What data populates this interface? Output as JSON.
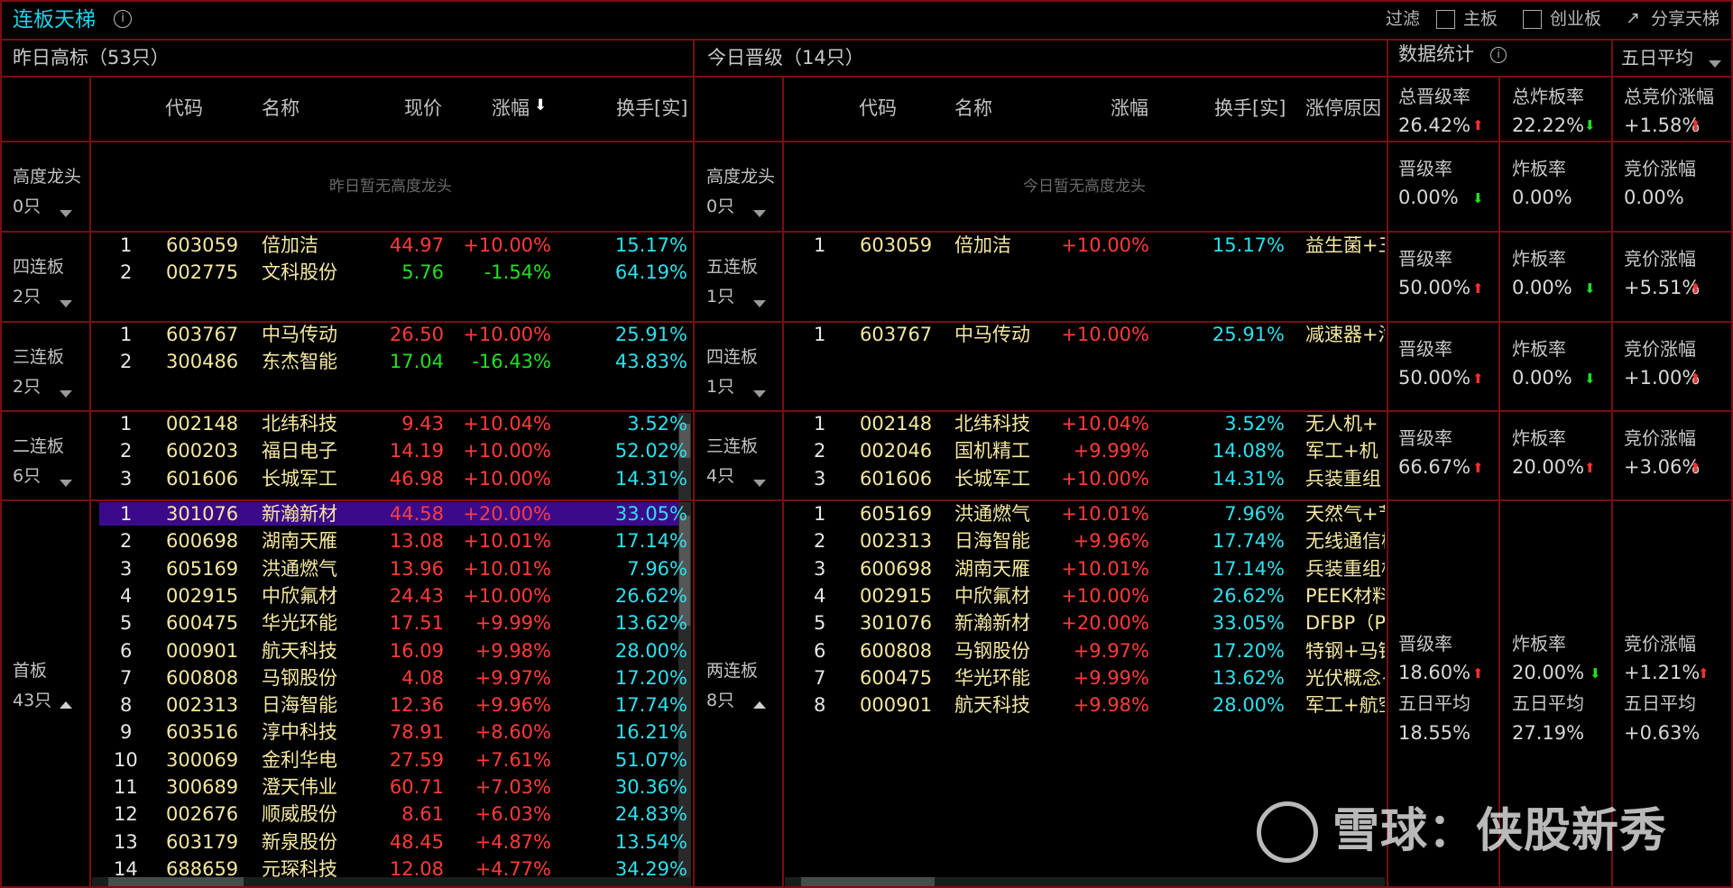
{
  "header": {
    "title": "连板天梯",
    "filter_label": "过滤",
    "main_board": "主板",
    "gem_board": "创业板",
    "share": "分享天梯"
  },
  "left": {
    "title": "昨日高标（53只）",
    "col_code": "代码",
    "col_name": "名称",
    "col_price": "现价",
    "col_change": "涨幅",
    "col_turnover": "换手[实]",
    "empty_text": "昨日暂无高度龙头"
  },
  "mid": {
    "title": "今日晋级（14只）",
    "col_code": "代码",
    "col_name": "名称",
    "col_change": "涨幅",
    "col_turnover": "换手[实]",
    "col_reason": "涨停原因",
    "empty_text": "今日暂无高度龙头"
  },
  "stats": {
    "title": "数据统计",
    "period": "五日平均",
    "total": [
      {
        "label": "总晋级率",
        "value": "26.42%",
        "dir": "up"
      },
      {
        "label": "总炸板率",
        "value": "22.22%",
        "dir": "down"
      },
      {
        "label": "总竞价涨幅",
        "value": "+1.58%",
        "dir": "up"
      }
    ]
  },
  "groups_left": [
    {
      "label": "高度龙头",
      "count": "0只"
    },
    {
      "label": "四连板",
      "count": "2只"
    },
    {
      "label": "三连板",
      "count": "2只"
    },
    {
      "label": "二连板",
      "count": "6只"
    },
    {
      "label": "首板",
      "count": "43只"
    }
  ],
  "groups_mid": [
    {
      "label": "高度龙头",
      "count": "0只"
    },
    {
      "label": "五连板",
      "count": "1只"
    },
    {
      "label": "四连板",
      "count": "1只"
    },
    {
      "label": "三连板",
      "count": "4只"
    },
    {
      "label": "两连板",
      "count": "8只"
    }
  ],
  "left_rows": {
    "g4": [
      {
        "i": "1",
        "code": "603059",
        "name": "倍加洁",
        "price": "44.97",
        "chg": "+10.00%",
        "to": "15.17%",
        "pc": "r"
      },
      {
        "i": "2",
        "code": "002775",
        "name": "文科股份",
        "price": "5.76",
        "chg": "-1.54%",
        "to": "64.19%",
        "pc": "g"
      }
    ],
    "g3": [
      {
        "i": "1",
        "code": "603767",
        "name": "中马传动",
        "price": "26.50",
        "chg": "+10.00%",
        "to": "25.91%",
        "pc": "r"
      },
      {
        "i": "2",
        "code": "300486",
        "name": "东杰智能",
        "price": "17.04",
        "chg": "-16.43%",
        "to": "43.83%",
        "pc": "g"
      }
    ],
    "g2": [
      {
        "i": "1",
        "code": "002148",
        "name": "北纬科技",
        "price": "9.43",
        "chg": "+10.04%",
        "to": "3.52%",
        "pc": "r"
      },
      {
        "i": "2",
        "code": "600203",
        "name": "福日电子",
        "price": "14.19",
        "chg": "+10.00%",
        "to": "52.02%",
        "pc": "r"
      },
      {
        "i": "3",
        "code": "601606",
        "name": "长城军工",
        "price": "46.98",
        "chg": "+10.00%",
        "to": "14.31%",
        "pc": "r"
      }
    ],
    "g1": [
      {
        "i": "1",
        "code": "301076",
        "name": "新瀚新材",
        "price": "44.58",
        "chg": "+20.00%",
        "to": "33.05%",
        "pc": "r"
      },
      {
        "i": "2",
        "code": "600698",
        "name": "湖南天雁",
        "price": "13.08",
        "chg": "+10.01%",
        "to": "17.14%",
        "pc": "r"
      },
      {
        "i": "3",
        "code": "605169",
        "name": "洪通燃气",
        "price": "13.96",
        "chg": "+10.01%",
        "to": "7.96%",
        "pc": "r"
      },
      {
        "i": "4",
        "code": "002915",
        "name": "中欣氟材",
        "price": "24.43",
        "chg": "+10.00%",
        "to": "26.62%",
        "pc": "r"
      },
      {
        "i": "5",
        "code": "600475",
        "name": "华光环能",
        "price": "17.51",
        "chg": "+9.99%",
        "to": "13.62%",
        "pc": "r"
      },
      {
        "i": "6",
        "code": "000901",
        "name": "航天科技",
        "price": "16.09",
        "chg": "+9.98%",
        "to": "28.00%",
        "pc": "r"
      },
      {
        "i": "7",
        "code": "600808",
        "name": "马钢股份",
        "price": "4.08",
        "chg": "+9.97%",
        "to": "17.20%",
        "pc": "r"
      },
      {
        "i": "8",
        "code": "002313",
        "name": "日海智能",
        "price": "12.36",
        "chg": "+9.96%",
        "to": "17.74%",
        "pc": "r"
      },
      {
        "i": "9",
        "code": "603516",
        "name": "淳中科技",
        "price": "78.91",
        "chg": "+8.60%",
        "to": "16.21%",
        "pc": "r"
      },
      {
        "i": "10",
        "code": "300069",
        "name": "金利华电",
        "price": "27.59",
        "chg": "+7.61%",
        "to": "51.07%",
        "pc": "r"
      },
      {
        "i": "11",
        "code": "300689",
        "name": "澄天伟业",
        "price": "60.71",
        "chg": "+7.03%",
        "to": "30.36%",
        "pc": "r"
      },
      {
        "i": "12",
        "code": "002676",
        "name": "顺威股份",
        "price": "8.61",
        "chg": "+6.03%",
        "to": "24.83%",
        "pc": "r"
      },
      {
        "i": "13",
        "code": "603179",
        "name": "新泉股份",
        "price": "48.45",
        "chg": "+4.87%",
        "to": "13.54%",
        "pc": "r"
      },
      {
        "i": "14",
        "code": "688659",
        "name": "元琛科技",
        "price": "12.08",
        "chg": "+4.77%",
        "to": "34.29%",
        "pc": "r"
      }
    ]
  },
  "mid_rows": {
    "g5": [
      {
        "i": "1",
        "code": "603059",
        "name": "倍加洁",
        "chg": "+10.00%",
        "to": "15.17%",
        "reason": "益生菌+三"
      }
    ],
    "g4": [
      {
        "i": "1",
        "code": "603767",
        "name": "中马传动",
        "chg": "+10.00%",
        "to": "25.91%",
        "reason": "减速器+汽"
      }
    ],
    "g3": [
      {
        "i": "1",
        "code": "002148",
        "name": "北纬科技",
        "chg": "+10.04%",
        "to": "3.52%",
        "reason": "无人机+"
      },
      {
        "i": "2",
        "code": "002046",
        "name": "国机精工",
        "chg": "+9.99%",
        "to": "14.08%",
        "reason": "军工+机"
      },
      {
        "i": "3",
        "code": "601606",
        "name": "长城军工",
        "chg": "+10.00%",
        "to": "14.31%",
        "reason": "兵装重组"
      }
    ],
    "g2": [
      {
        "i": "1",
        "code": "605169",
        "name": "洪通燃气",
        "chg": "+10.01%",
        "to": "7.96%",
        "reason": "天然气+节"
      },
      {
        "i": "2",
        "code": "002313",
        "name": "日海智能",
        "chg": "+9.96%",
        "to": "17.74%",
        "reason": "无线通信模"
      },
      {
        "i": "3",
        "code": "600698",
        "name": "湖南天雁",
        "chg": "+10.01%",
        "to": "17.14%",
        "reason": "兵装重组核"
      },
      {
        "i": "4",
        "code": "002915",
        "name": "中欣氟材",
        "chg": "+10.00%",
        "to": "26.62%",
        "reason": "PEEK材料"
      },
      {
        "i": "5",
        "code": "301076",
        "name": "新瀚新材",
        "chg": "+20.00%",
        "to": "33.05%",
        "reason": "DFBP（P"
      },
      {
        "i": "6",
        "code": "600808",
        "name": "马钢股份",
        "chg": "+9.97%",
        "to": "17.20%",
        "reason": "特钢+马钢"
      },
      {
        "i": "7",
        "code": "600475",
        "name": "华光环能",
        "chg": "+9.99%",
        "to": "13.62%",
        "reason": "光伏概念+"
      },
      {
        "i": "8",
        "code": "000901",
        "name": "航天科技",
        "chg": "+9.98%",
        "to": "28.00%",
        "reason": "军工+航空"
      }
    ]
  },
  "stat_rows": [
    {
      "a": "晋级率",
      "av": "0.00%",
      "ad": "down",
      "b": "炸板率",
      "bv": "0.00%",
      "bd": "",
      "c": "竞价涨幅",
      "cv": "0.00%",
      "cd": "",
      "cc": "w"
    },
    {
      "a": "晋级率",
      "av": "50.00%",
      "ad": "up",
      "b": "炸板率",
      "bv": "0.00%",
      "bd": "down",
      "c": "竞价涨幅",
      "cv": "+5.51%",
      "cd": "up",
      "cc": "r"
    },
    {
      "a": "晋级率",
      "av": "50.00%",
      "ad": "up",
      "b": "炸板率",
      "bv": "0.00%",
      "bd": "down",
      "c": "竞价涨幅",
      "cv": "+1.00%",
      "cd": "up",
      "cc": "r"
    },
    {
      "a": "晋级率",
      "av": "66.67%",
      "ad": "up",
      "b": "炸板率",
      "bv": "20.00%",
      "bd": "up",
      "c": "竞价涨幅",
      "cv": "+3.06%",
      "cd": "up",
      "cc": "r"
    }
  ],
  "stat_last": {
    "a": "晋级率",
    "av": "18.60%",
    "b": "炸板率",
    "bv": "20.00%",
    "c": "竞价涨幅",
    "cv": "+1.21%",
    "avg_label": "五日平均",
    "avg_a": "18.55%",
    "avg_b": "27.19%",
    "avg_c": "+0.63%"
  },
  "watermark": "雪球：侠股新秀"
}
